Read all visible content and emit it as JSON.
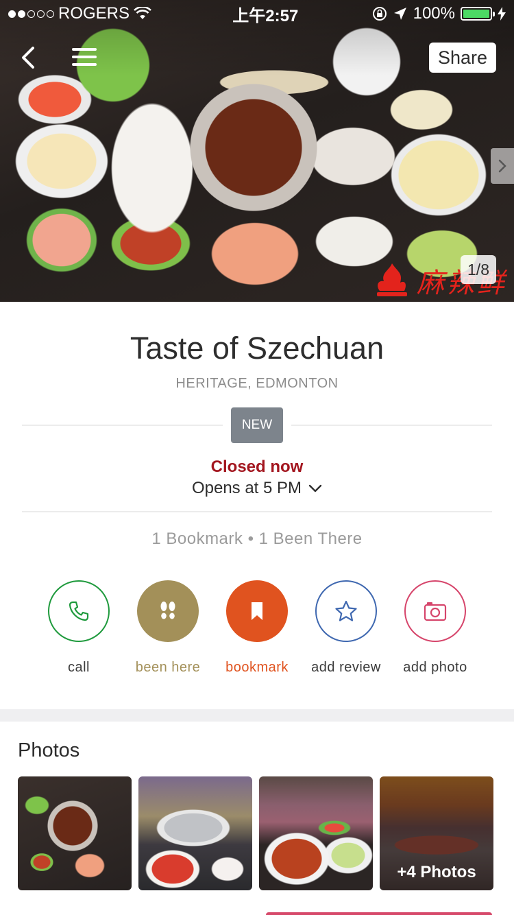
{
  "status_bar": {
    "carrier": "ROGERS",
    "time": "上午2:57",
    "battery": "100%",
    "signal_bars_filled": 2,
    "signal_bars_total": 5
  },
  "hero": {
    "share_label": "Share",
    "photo_counter": "1/8",
    "watermark": "麻辣鲜"
  },
  "restaurant": {
    "name": "Taste of Szechuan",
    "location": "HERITAGE, EDMONTON",
    "badge": "NEW",
    "status": "Closed now",
    "opens": "Opens at 5 PM",
    "stats": "1 Bookmark • 1 Been There"
  },
  "actions": [
    {
      "id": "call",
      "label": "call",
      "icon": "phone-icon",
      "color": "#1f9a3d",
      "filled": false
    },
    {
      "id": "been-here",
      "label": "been here",
      "icon": "footprints-icon",
      "color": "#a39059",
      "filled": true
    },
    {
      "id": "bookmark",
      "label": "bookmark",
      "icon": "bookmark-icon",
      "color": "#e0531f",
      "filled": true
    },
    {
      "id": "add-review",
      "label": "add review",
      "icon": "star-icon",
      "color": "#3f68b0",
      "filled": false
    },
    {
      "id": "add-photo",
      "label": "add photo",
      "icon": "camera-icon",
      "color": "#d6456b",
      "filled": false
    }
  ],
  "photos": {
    "title": "Photos",
    "more_label": "+4 Photos"
  },
  "colors": {
    "closed_red": "#a3161f",
    "badge_gray": "#7d848c",
    "battery_green": "#4cd964"
  }
}
